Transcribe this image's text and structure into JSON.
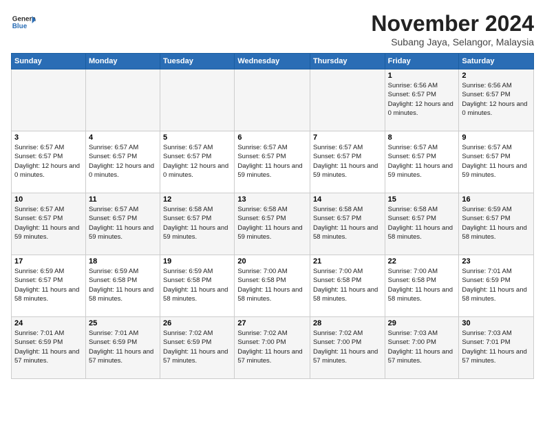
{
  "header": {
    "logo_general": "General",
    "logo_blue": "Blue",
    "month_title": "November 2024",
    "location": "Subang Jaya, Selangor, Malaysia"
  },
  "days_of_week": [
    "Sunday",
    "Monday",
    "Tuesday",
    "Wednesday",
    "Thursday",
    "Friday",
    "Saturday"
  ],
  "weeks": [
    [
      {
        "day": "",
        "info": ""
      },
      {
        "day": "",
        "info": ""
      },
      {
        "day": "",
        "info": ""
      },
      {
        "day": "",
        "info": ""
      },
      {
        "day": "",
        "info": ""
      },
      {
        "day": "1",
        "info": "Sunrise: 6:56 AM\nSunset: 6:57 PM\nDaylight: 12 hours and 0 minutes."
      },
      {
        "day": "2",
        "info": "Sunrise: 6:56 AM\nSunset: 6:57 PM\nDaylight: 12 hours and 0 minutes."
      }
    ],
    [
      {
        "day": "3",
        "info": "Sunrise: 6:57 AM\nSunset: 6:57 PM\nDaylight: 12 hours and 0 minutes."
      },
      {
        "day": "4",
        "info": "Sunrise: 6:57 AM\nSunset: 6:57 PM\nDaylight: 12 hours and 0 minutes."
      },
      {
        "day": "5",
        "info": "Sunrise: 6:57 AM\nSunset: 6:57 PM\nDaylight: 12 hours and 0 minutes."
      },
      {
        "day": "6",
        "info": "Sunrise: 6:57 AM\nSunset: 6:57 PM\nDaylight: 11 hours and 59 minutes."
      },
      {
        "day": "7",
        "info": "Sunrise: 6:57 AM\nSunset: 6:57 PM\nDaylight: 11 hours and 59 minutes."
      },
      {
        "day": "8",
        "info": "Sunrise: 6:57 AM\nSunset: 6:57 PM\nDaylight: 11 hours and 59 minutes."
      },
      {
        "day": "9",
        "info": "Sunrise: 6:57 AM\nSunset: 6:57 PM\nDaylight: 11 hours and 59 minutes."
      }
    ],
    [
      {
        "day": "10",
        "info": "Sunrise: 6:57 AM\nSunset: 6:57 PM\nDaylight: 11 hours and 59 minutes."
      },
      {
        "day": "11",
        "info": "Sunrise: 6:57 AM\nSunset: 6:57 PM\nDaylight: 11 hours and 59 minutes."
      },
      {
        "day": "12",
        "info": "Sunrise: 6:58 AM\nSunset: 6:57 PM\nDaylight: 11 hours and 59 minutes."
      },
      {
        "day": "13",
        "info": "Sunrise: 6:58 AM\nSunset: 6:57 PM\nDaylight: 11 hours and 59 minutes."
      },
      {
        "day": "14",
        "info": "Sunrise: 6:58 AM\nSunset: 6:57 PM\nDaylight: 11 hours and 58 minutes."
      },
      {
        "day": "15",
        "info": "Sunrise: 6:58 AM\nSunset: 6:57 PM\nDaylight: 11 hours and 58 minutes."
      },
      {
        "day": "16",
        "info": "Sunrise: 6:59 AM\nSunset: 6:57 PM\nDaylight: 11 hours and 58 minutes."
      }
    ],
    [
      {
        "day": "17",
        "info": "Sunrise: 6:59 AM\nSunset: 6:57 PM\nDaylight: 11 hours and 58 minutes."
      },
      {
        "day": "18",
        "info": "Sunrise: 6:59 AM\nSunset: 6:58 PM\nDaylight: 11 hours and 58 minutes."
      },
      {
        "day": "19",
        "info": "Sunrise: 6:59 AM\nSunset: 6:58 PM\nDaylight: 11 hours and 58 minutes."
      },
      {
        "day": "20",
        "info": "Sunrise: 7:00 AM\nSunset: 6:58 PM\nDaylight: 11 hours and 58 minutes."
      },
      {
        "day": "21",
        "info": "Sunrise: 7:00 AM\nSunset: 6:58 PM\nDaylight: 11 hours and 58 minutes."
      },
      {
        "day": "22",
        "info": "Sunrise: 7:00 AM\nSunset: 6:58 PM\nDaylight: 11 hours and 58 minutes."
      },
      {
        "day": "23",
        "info": "Sunrise: 7:01 AM\nSunset: 6:59 PM\nDaylight: 11 hours and 58 minutes."
      }
    ],
    [
      {
        "day": "24",
        "info": "Sunrise: 7:01 AM\nSunset: 6:59 PM\nDaylight: 11 hours and 57 minutes."
      },
      {
        "day": "25",
        "info": "Sunrise: 7:01 AM\nSunset: 6:59 PM\nDaylight: 11 hours and 57 minutes."
      },
      {
        "day": "26",
        "info": "Sunrise: 7:02 AM\nSunset: 6:59 PM\nDaylight: 11 hours and 57 minutes."
      },
      {
        "day": "27",
        "info": "Sunrise: 7:02 AM\nSunset: 7:00 PM\nDaylight: 11 hours and 57 minutes."
      },
      {
        "day": "28",
        "info": "Sunrise: 7:02 AM\nSunset: 7:00 PM\nDaylight: 11 hours and 57 minutes."
      },
      {
        "day": "29",
        "info": "Sunrise: 7:03 AM\nSunset: 7:00 PM\nDaylight: 11 hours and 57 minutes."
      },
      {
        "day": "30",
        "info": "Sunrise: 7:03 AM\nSunset: 7:01 PM\nDaylight: 11 hours and 57 minutes."
      }
    ]
  ]
}
